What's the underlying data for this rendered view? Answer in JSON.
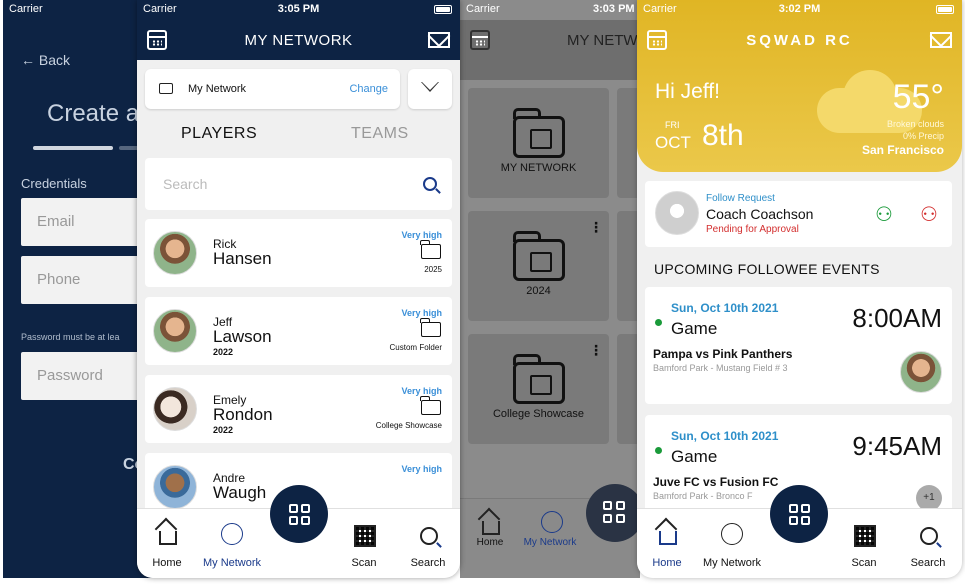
{
  "phone1": {
    "carrier": "Carrier",
    "back": "Back",
    "title": "Create a",
    "section": "Credentials",
    "email": "Email",
    "phone": "Phone",
    "hint": "Password must be at lea",
    "password": "Password",
    "continue": "Co"
  },
  "phone2": {
    "carrier": "Carrier",
    "time": "3:05 PM",
    "title": "MY NETWORK",
    "network_name": "My Network",
    "change": "Change",
    "tabs": [
      "PLAYERS",
      "TEAMS"
    ],
    "search_placeholder": "Search",
    "players": [
      {
        "first": "Rick",
        "last": "Hansen",
        "year": "",
        "level": "Very high",
        "folder": "2025"
      },
      {
        "first": "Jeff",
        "last": "Lawson",
        "year": "2022",
        "level": "Very high",
        "folder": "Custom Folder"
      },
      {
        "first": "Emely",
        "last": "Rondon",
        "year": "2022",
        "level": "Very high",
        "folder": "College Showcase"
      },
      {
        "first": "Andre",
        "last": "Waugh",
        "year": "",
        "level": "Very high",
        "folder": ""
      }
    ],
    "nav": [
      "Home",
      "My Network",
      "Scan",
      "Search"
    ]
  },
  "phone3": {
    "carrier": "Carrier",
    "time": "3:03 PM",
    "title": "MY NETWO",
    "tiles": [
      "MY NETWORK",
      "2024",
      "College Showcase"
    ],
    "nav": [
      "Home",
      "My Network"
    ]
  },
  "phone4": {
    "carrier": "Carrier",
    "time": "3:02 PM",
    "title": "SQWAD RC",
    "greeting": "Hi Jeff!",
    "day": "FRI",
    "month": "OCT",
    "date": "8th",
    "temp": "55°",
    "weather": "Broken clouds",
    "precip": "0% Precip",
    "city": "San Francisco",
    "follow": {
      "label": "Follow Request",
      "name": "Coach Coachson",
      "status": "Pending for Approval"
    },
    "events_header": "UPCOMING FOLLOWEE EVENTS",
    "events": [
      {
        "date": "Sun, Oct 10th 2021",
        "type": "Game",
        "time": "8:00AM",
        "match": "Pampa vs Pink Panthers",
        "location": "Bamford Park - Mustang Field # 3"
      },
      {
        "date": "Sun, Oct 10th 2021",
        "type": "Game",
        "time": "9:45AM",
        "match": "Juve FC vs Fusion FC",
        "location": "Bamford Park - Bronco F",
        "extra": "+1"
      }
    ],
    "nav": [
      "Home",
      "My Network",
      "Scan",
      "Search"
    ]
  },
  "colors": {
    "navy": "#0d2344",
    "gold": "#e0b524",
    "accent": "#3a8fd8",
    "green": "#1a9a3a",
    "red": "#d32f2f"
  }
}
